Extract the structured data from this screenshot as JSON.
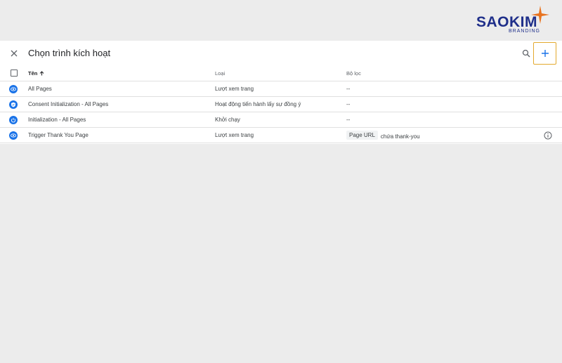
{
  "brand": {
    "name": "SAOKIM",
    "sub": "BRANDING",
    "color": "#1f2f8a",
    "accent": "#e8731f"
  },
  "panel": {
    "title": "Chọn trình kích hoạt",
    "accent_border": "#e3a92e",
    "primary": "#1a73e8"
  },
  "table": {
    "headers": {
      "name": "Tên",
      "type": "Loại",
      "filter": "Bộ lọc"
    },
    "rows": [
      {
        "icon": "eye-icon",
        "name": "All Pages",
        "type": "Lượt xem trang",
        "filter": "--"
      },
      {
        "icon": "consent-shield-icon",
        "name": "Consent Initialization - All Pages",
        "type": "Hoạt động tiến hành lấy sự đồng ý",
        "filter": "--"
      },
      {
        "icon": "power-icon",
        "name": "Initialization - All Pages",
        "type": "Khởi chạy",
        "filter": "--"
      },
      {
        "icon": "eye-icon",
        "name": "Trigger Thank You Page",
        "type": "Lượt xem trang",
        "filter_chip": "Page URL",
        "filter_text": "chứa thank-you"
      }
    ]
  }
}
